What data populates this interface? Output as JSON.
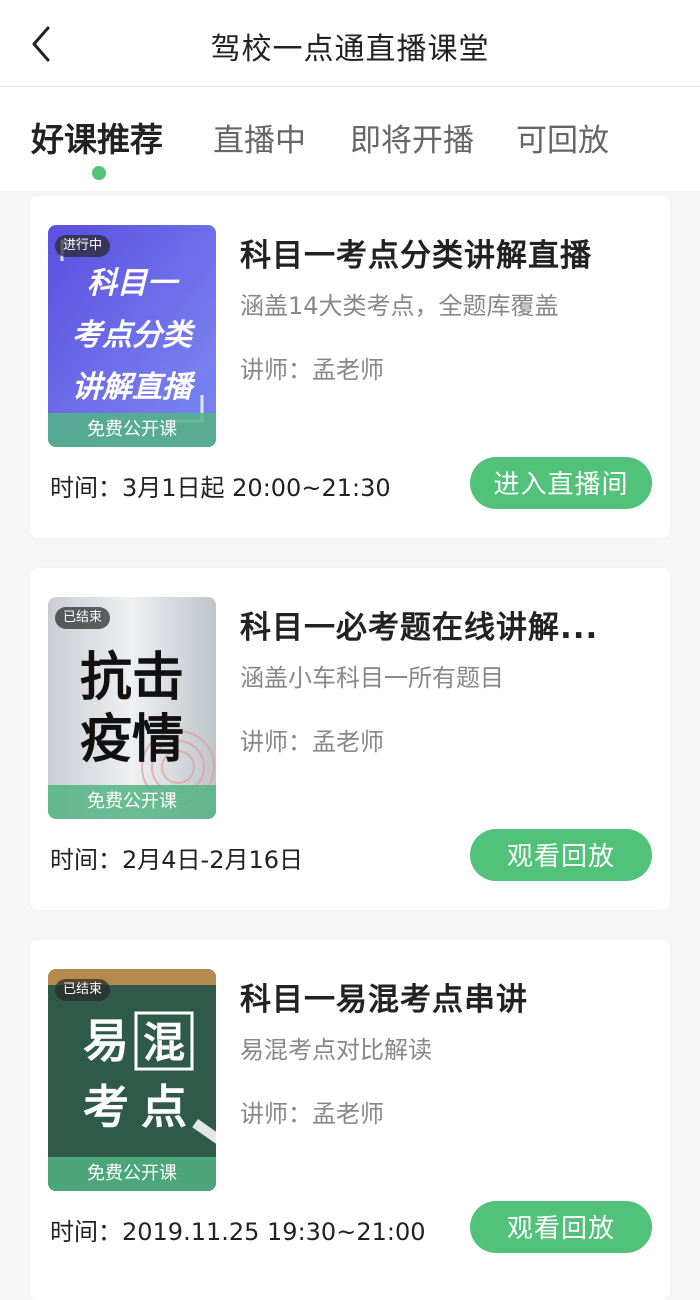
{
  "navbar": {
    "title": "驾校一点通直播课堂"
  },
  "tabs": [
    {
      "label": "好课推荐",
      "active": true
    },
    {
      "label": "直播中",
      "active": false
    },
    {
      "label": "即将开播",
      "active": false
    },
    {
      "label": "可回放",
      "active": false
    }
  ],
  "courses": [
    {
      "status_badge": "进行中",
      "thumb_tag": "免费公开课",
      "thumb_text": [
        "科目一",
        "考点分类",
        "讲解直播"
      ],
      "title": "科目一考点分类讲解直播",
      "subtitle": "涵盖14大类考点，全题库覆盖",
      "teacher": "讲师：孟老师",
      "time": "时间：3月1日起 20:00~21:30",
      "button": "进入直播间"
    },
    {
      "status_badge": "已结束",
      "thumb_tag": "免费公开课",
      "thumb_text": [
        "抗击",
        "疫情"
      ],
      "title": "科目一必考题在线讲解...",
      "subtitle": "涵盖小车科目一所有题目",
      "teacher": "讲师：孟老师",
      "time": "时间：2月4日-2月16日",
      "button": "观看回放"
    },
    {
      "status_badge": "已结束",
      "thumb_tag": "免费公开课",
      "thumb_text": [
        "易",
        "混",
        "考",
        "点"
      ],
      "title": "科目一易混考点串讲",
      "subtitle": "易混考点对比解读",
      "teacher": "讲师：孟老师",
      "time": "时间：2019.11.25 19:30~21:00",
      "button": "观看回放"
    }
  ],
  "colors": {
    "accent": "#52c17a",
    "tab_inactive": "#666666",
    "text_secondary": "#888888"
  }
}
